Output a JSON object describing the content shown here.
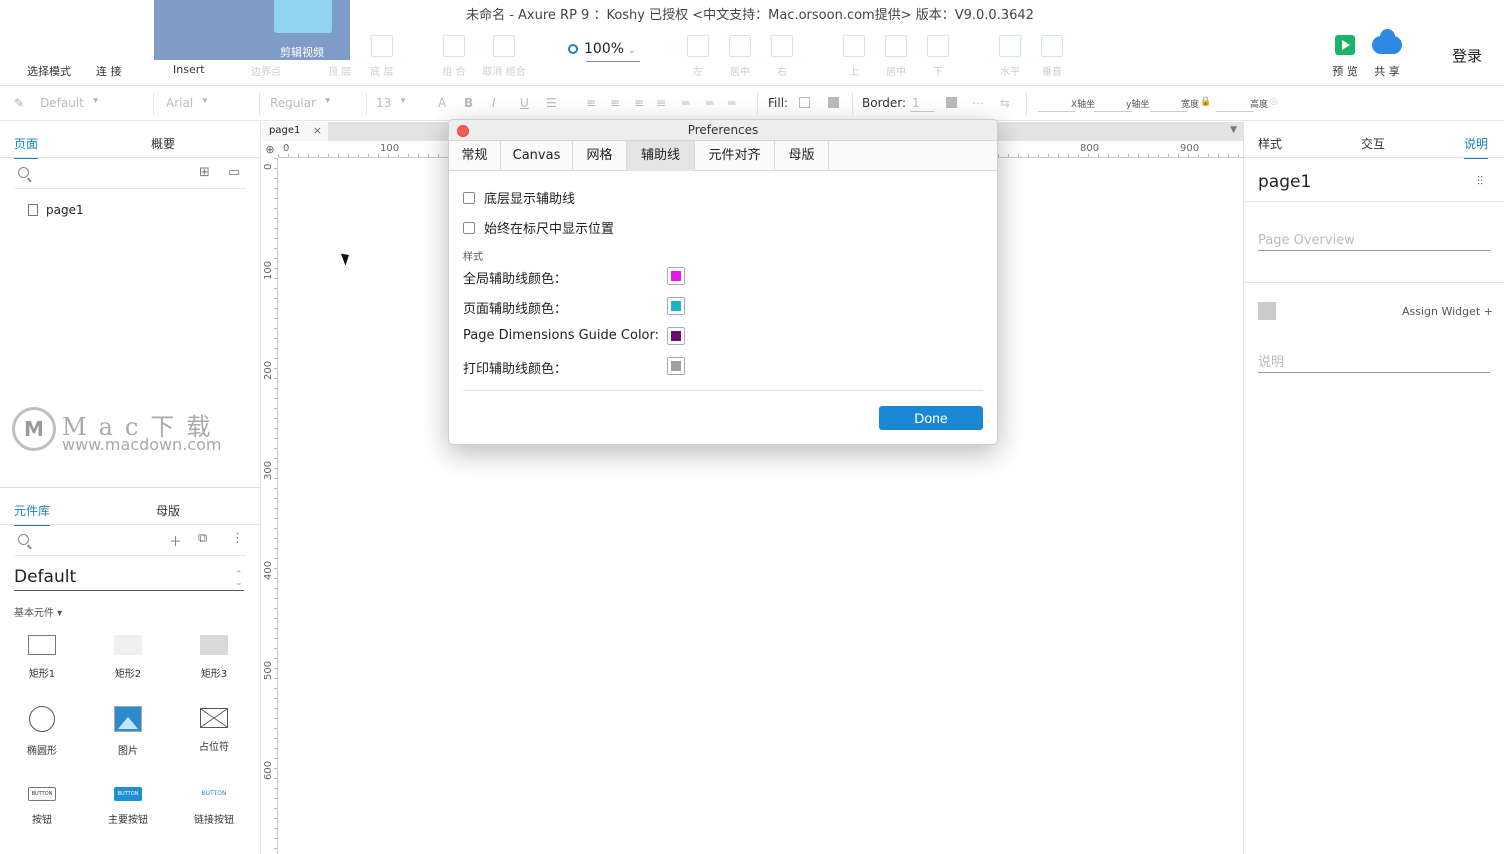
{
  "window": {
    "title": "未命名 - Axure RP 9 ：Koshy 已授权     <中文支持：Mac.orsoon.com提供> 版本：V9.0.0.3642"
  },
  "toolbar": {
    "select_mode": "选择模式",
    "connect": "连 接",
    "insert": "Insert",
    "video_label": "剪辑视频",
    "points": "边界点",
    "top_layer": "顶 层",
    "bottom_layer": "底 层",
    "group": "组 合",
    "ungroup": "取消 组合",
    "zoom": "100%",
    "align_left": "左",
    "align_center": "居中",
    "align_right": "右",
    "align_top": "上",
    "align_middle": "居中",
    "align_bottom": "下",
    "distribute_h": "水平",
    "distribute_v": "垂直",
    "preview": "预 览",
    "share": "共 享",
    "login": "登录"
  },
  "formatbar": {
    "style": "Default",
    "font": "Arial",
    "weight": "Regular",
    "size": "13",
    "fill_label": "Fill:",
    "border_label": "Border:",
    "border_value": "1",
    "x_label": "X轴坐",
    "y_label": "y轴坐",
    "w_label": "宽度",
    "h_label": "高度"
  },
  "left": {
    "tabs": [
      "页面",
      "概要"
    ],
    "pages": [
      "page1"
    ],
    "lib_tabs": [
      "元件库",
      "母版"
    ],
    "library": "Default",
    "category": "基本元件 ▾",
    "widgets": [
      "矩形1",
      "矩形2",
      "矩形3",
      "椭圆形",
      "图片",
      "占位符",
      "按钮",
      "主要按钮",
      "链接按钮"
    ],
    "button_text": "BUTTON",
    "watermark_big": "Mac下载",
    "watermark_url": "www.macdown.com"
  },
  "canvas": {
    "tab": "page1",
    "ruler_top": [
      "0",
      "100",
      "800",
      "900"
    ],
    "ruler_left": [
      "0",
      "100",
      "200",
      "300",
      "400",
      "500",
      "600"
    ]
  },
  "right": {
    "tabs": [
      "样式",
      "交互",
      "说明"
    ],
    "page_name": "page1",
    "overview_placeholder": "Page Overview",
    "assign_widget": "Assign Widget +",
    "notes_placeholder": "说明"
  },
  "dialog": {
    "title": "Preferences",
    "tabs": [
      "常规",
      "Canvas",
      "网格",
      "辅助线",
      "元件对齐",
      "母版"
    ],
    "active_tab": "辅助线",
    "checkboxes": [
      "底层显示辅助线",
      "始终在标尺中显示位置"
    ],
    "section": "样式",
    "colors": [
      {
        "label": "全局辅助线颜色：",
        "color": "#e619e6"
      },
      {
        "label": "页面辅助线颜色：",
        "color": "#1cb3c8"
      },
      {
        "label": "Page Dimensions Guide Color:",
        "color": "#6e0a78"
      },
      {
        "label": "打印辅助线颜色：",
        "color": "#a0a0a0"
      }
    ],
    "done": "Done"
  }
}
